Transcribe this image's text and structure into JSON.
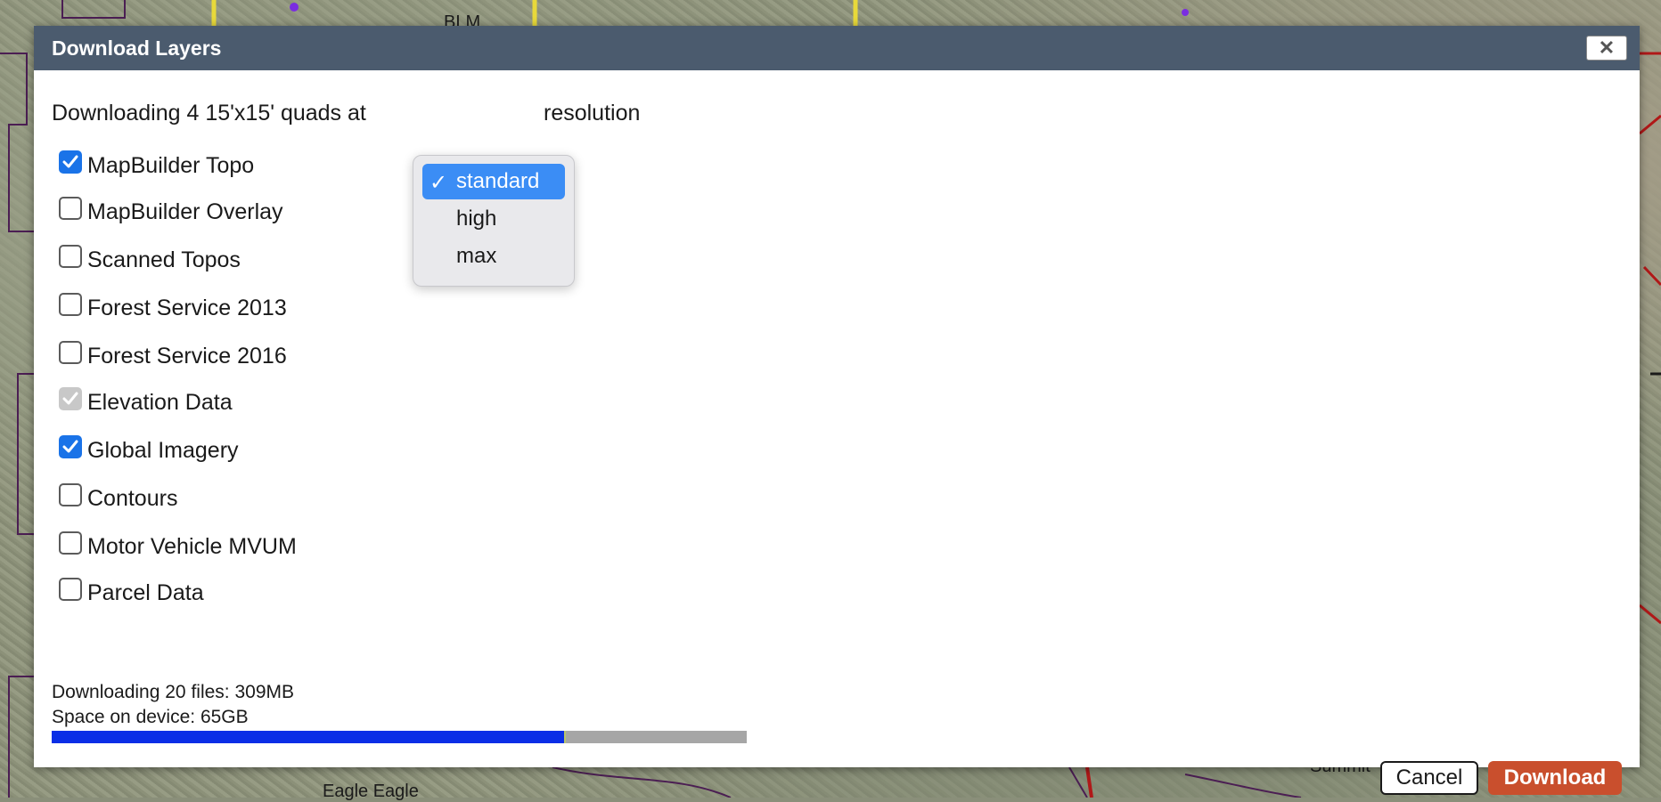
{
  "map": {
    "labels": [
      "BLM",
      "Eagle Eagle",
      "Summit"
    ]
  },
  "dialog": {
    "title": "Download Layers",
    "close_icon": "close-icon",
    "intro_prefix": "Downloading 4 15'x15' quads at",
    "intro_suffix": "resolution",
    "resolution": {
      "selected": "standard",
      "options": [
        "standard",
        "high",
        "max"
      ]
    },
    "layers": [
      {
        "label": "MapBuilder Topo",
        "checked": true,
        "disabled": false
      },
      {
        "label": "MapBuilder Overlay",
        "checked": false,
        "disabled": false
      },
      {
        "label": "Scanned Topos",
        "checked": false,
        "disabled": false
      },
      {
        "label": "Forest Service 2013",
        "checked": false,
        "disabled": false
      },
      {
        "label": "Forest Service 2016",
        "checked": false,
        "disabled": false
      },
      {
        "label": "Elevation Data",
        "checked": true,
        "disabled": true
      },
      {
        "label": "Global Imagery",
        "checked": true,
        "disabled": false
      },
      {
        "label": "Contours",
        "checked": false,
        "disabled": false
      },
      {
        "label": "Motor Vehicle MVUM",
        "checked": false,
        "disabled": false
      },
      {
        "label": "Parcel Data",
        "checked": false,
        "disabled": false
      }
    ],
    "downloading_text": "Downloading 20 files: 309MB",
    "space_text": "Space on device: 65GB",
    "usage_fraction": 0.74,
    "cancel_label": "Cancel",
    "download_label": "Download",
    "colors": {
      "titlebar": "#4b5b6e",
      "checkbox_checked": "#1a73e8",
      "progress_fill": "#0a2ee6",
      "download_button": "#c94f2d",
      "dropdown_selected": "#3b8df5"
    }
  }
}
